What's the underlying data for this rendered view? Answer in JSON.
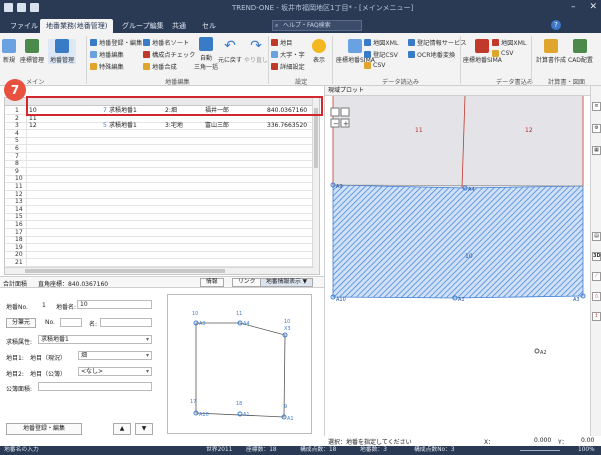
{
  "window": {
    "title": "TREND-ONE - 坂井市福岡地区1丁目* - [メインメニュー]",
    "help_icon": "?"
  },
  "tabs": [
    {
      "label": "ファイル"
    },
    {
      "label": "地番業務(地番管理)"
    },
    {
      "label": "グループ編集"
    },
    {
      "label": "共通"
    },
    {
      "label": "セル"
    }
  ],
  "search": {
    "placeholder": "ヘルプ・FAQ検索"
  },
  "ribbon": {
    "buttons_left": {
      "b1": "新規",
      "b2": "座標管理",
      "b3": "地番管理"
    },
    "edit_items": [
      "地番登録・編集",
      "地番編集",
      "特殊編集"
    ],
    "edit_items2": [
      "地番名ソート",
      "構成点チェック",
      "地番合成"
    ],
    "auto_label": "自動",
    "sankaku_label": "三角一括",
    "undo_label": "元に戻す",
    "redo_label": "やり直し",
    "text_items": [
      "地目",
      "大字・字",
      "詳細設定"
    ],
    "display_label": "表示",
    "input_items": [
      "地図XML",
      "登記CSV",
      "CSV"
    ],
    "input_items2": [
      "登記情報サービス",
      "OCR地番変換"
    ],
    "sima_label": "座標地番SIMA",
    "output_items": [
      "地図XML",
      "CSV"
    ],
    "out_sima_label": "座標地番SIMA",
    "calc_label": "計算書作成",
    "cad_label": "CAD配置",
    "groups": {
      "main": "メイン",
      "chiban": "地番編集",
      "settei": "設定",
      "dataread": "データ読込み",
      "datawrite": "データ書込み",
      "keisansho": "計算書・図面"
    }
  },
  "grid": {
    "rows": [
      {
        "no": "1",
        "name": "10",
        "label": "7",
        "type": "求積地番1",
        "cat": "2:畑",
        "owner": "福井一郎",
        "area": "840.0367160"
      },
      {
        "no": "2",
        "name": "11",
        "label": "",
        "type": "",
        "cat": "",
        "owner": "",
        "area": ""
      },
      {
        "no": "3",
        "name": "12",
        "label": "5",
        "type": "求積地番1",
        "cat": "3:宅地",
        "owner": "富山三郎",
        "area": "336.7663520"
      },
      {
        "no": "4"
      },
      {
        "no": "5"
      },
      {
        "no": "6"
      },
      {
        "no": "7"
      },
      {
        "no": "8"
      },
      {
        "no": "9"
      },
      {
        "no": "10"
      },
      {
        "no": "11"
      },
      {
        "no": "12"
      },
      {
        "no": "13"
      },
      {
        "no": "14"
      },
      {
        "no": "15"
      },
      {
        "no": "16"
      },
      {
        "no": "17"
      },
      {
        "no": "18"
      },
      {
        "no": "19"
      },
      {
        "no": "20"
      },
      {
        "no": "21"
      },
      {
        "no": "22"
      }
    ]
  },
  "badge": "7",
  "info": {
    "total_area_label": "合計面積",
    "area_text": "直角座標：840.0367160",
    "info_button": "情報",
    "link_button": "リンク",
    "display_button": "地番情報表示 ▼"
  },
  "form": {
    "chiban_no_label": "地番No.",
    "chiban_no_value": "1",
    "chiban_name_label": "地番名:",
    "chiban_name_value": "10",
    "bunka_label": "分筆元",
    "no_label": "No.",
    "name_label": "名:",
    "kyuseki_label": "求積属性:",
    "kyuseki_value": "求積地番1",
    "chimoku1_label": "地目1:",
    "chimoku_genkyo": "地目（現況）",
    "chimoku_genkyo_value": "畑",
    "chimoku2_label": "地目2:",
    "chimoku_kobo": "地目（公簿）",
    "chimoku_kobo_value": "<なし>",
    "kohousyo_label": "公簿面積:",
    "register_button": "地番登録・編集",
    "up_button": "▲",
    "down_button": "▼"
  },
  "preview": {
    "labels": [
      "10",
      "11",
      "10",
      "X3",
      "A9",
      "A4",
      "17",
      "18",
      "9",
      "A10",
      "A1",
      "A1"
    ]
  },
  "map": {
    "title": "現域プロット",
    "labels": [
      "11",
      "12",
      "10",
      "A10",
      "A4",
      "A1",
      "A9",
      "A2",
      "A3"
    ],
    "colors": {
      "hatch": "#3d7fd6",
      "fill": "#e4e4e8",
      "line": "#c0392b"
    }
  },
  "map_status": {
    "select_text": "選択：地番を指定してください",
    "x_label": "X：",
    "x_value": "0.000",
    "y_label": "Y：",
    "y_value": "0.00"
  },
  "right_tools": [
    "3D"
  ],
  "statusbar": {
    "left": "地番名の入力",
    "world": "世界2011",
    "zahyo": "座標数：18",
    "kousei": "構成点数：18",
    "chibansu": "地番数：3",
    "kouseiten": "構成点数No：3",
    "zoom": "100%"
  }
}
